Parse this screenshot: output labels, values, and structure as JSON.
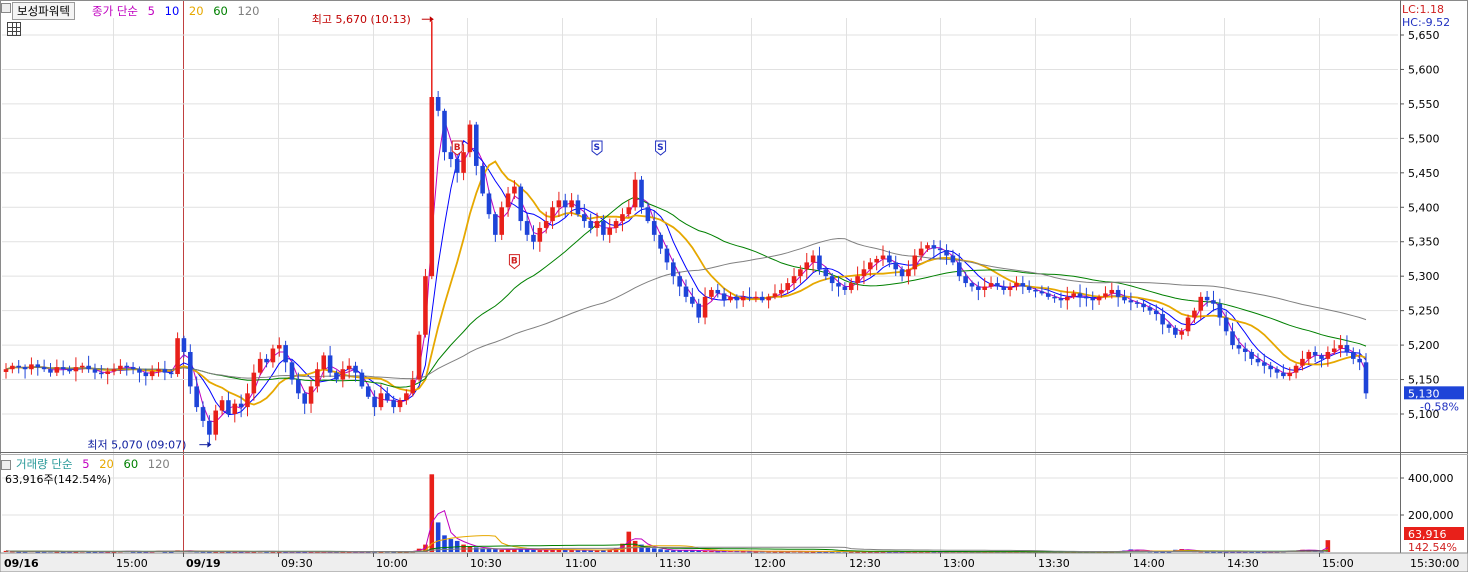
{
  "header": {
    "stock_name": "보성파워텍",
    "ma_prefix": "종가 단순",
    "ma_periods": [
      "5",
      "10",
      "20",
      "60",
      "120"
    ],
    "ma_colors": [
      "#c000c0",
      "#0000ff",
      "#e6a800",
      "#008000",
      "#808080"
    ]
  },
  "volume_header": {
    "label": "거래량 단순",
    "ma_periods": [
      "5",
      "20",
      "60",
      "120"
    ],
    "current": "63,916주(142.54%)"
  },
  "indicators": {
    "lc": "LC:1.18",
    "hc": "HC:-9.52"
  },
  "current_price": {
    "value": "5,130",
    "change": "-0.58%"
  },
  "current_volume": {
    "value": "63,916",
    "ratio": "142.54%"
  },
  "annotations": {
    "high": "최고 5,670 (10:13)",
    "low": "최저 5,070 (09:07)",
    "buy_label": "B",
    "sell_label": "S"
  },
  "colors": {
    "up": "#e8201a",
    "down": "#1e44d8",
    "grid": "#e1e1e1",
    "axis_bg": "#ffffff"
  },
  "chart_data": [
    {
      "type": "candlestick",
      "title": "",
      "x_ticks": [
        "09/16",
        "15:00",
        "09/19",
        "09:30",
        "10:00",
        "10:30",
        "11:00",
        "11:30",
        "12:00",
        "12:30",
        "13:00",
        "13:30",
        "14:00",
        "14:30",
        "15:00",
        "15:30:00"
      ],
      "y_ticks": [
        "5,100",
        "5,150",
        "5,200",
        "5,250",
        "5,300",
        "5,350",
        "5,400",
        "5,450",
        "5,500",
        "5,550",
        "5,600",
        "5,650"
      ],
      "ylim": [
        5060,
        5670
      ],
      "high": 5670,
      "low": 5070,
      "price_path": [
        5165,
        5170,
        5168,
        5165,
        5172,
        5168,
        5165,
        5160,
        5168,
        5165,
        5162,
        5168,
        5170,
        5165,
        5160,
        5158,
        5162,
        5165,
        5170,
        5168,
        5165,
        5160,
        5155,
        5162,
        5165,
        5160,
        5158,
        5210,
        5190,
        5140,
        5110,
        5090,
        5070,
        5105,
        5120,
        5100,
        5115,
        5110,
        5130,
        5160,
        5180,
        5175,
        5195,
        5200,
        5175,
        5150,
        5130,
        5115,
        5140,
        5165,
        5185,
        5160,
        5150,
        5165,
        5170,
        5160,
        5140,
        5125,
        5110,
        5130,
        5120,
        5110,
        5120,
        5130,
        5150,
        5215,
        5300,
        5560,
        5540,
        5480,
        5470,
        5450,
        5480,
        5520,
        5460,
        5420,
        5390,
        5360,
        5400,
        5420,
        5430,
        5380,
        5360,
        5350,
        5370,
        5380,
        5400,
        5410,
        5400,
        5410,
        5390,
        5380,
        5370,
        5380,
        5360,
        5370,
        5380,
        5390,
        5400,
        5440,
        5400,
        5380,
        5360,
        5340,
        5320,
        5300,
        5285,
        5270,
        5260,
        5240,
        5270,
        5280,
        5275,
        5265,
        5270,
        5265,
        5270,
        5268,
        5270,
        5265,
        5270,
        5275,
        5280,
        5290,
        5300,
        5310,
        5320,
        5330,
        5310,
        5300,
        5290,
        5285,
        5280,
        5290,
        5300,
        5310,
        5320,
        5325,
        5330,
        5320,
        5310,
        5300,
        5310,
        5330,
        5340,
        5345,
        5340,
        5338,
        5330,
        5320,
        5300,
        5290,
        5285,
        5280,
        5285,
        5290,
        5285,
        5280,
        5285,
        5290,
        5285,
        5280,
        5278,
        5275,
        5270,
        5268,
        5265,
        5270,
        5275,
        5270,
        5268,
        5265,
        5270,
        5275,
        5280,
        5270,
        5265,
        5262,
        5260,
        5255,
        5250,
        5245,
        5230,
        5225,
        5215,
        5220,
        5240,
        5250,
        5270,
        5265,
        5260,
        5240,
        5220,
        5200,
        5195,
        5190,
        5180,
        5175,
        5170,
        5165,
        5160,
        5155,
        5160,
        5170,
        5180,
        5190,
        5185,
        5180,
        5190,
        5195,
        5200,
        5190,
        5180,
        5175,
        5130
      ]
    },
    {
      "type": "bar",
      "title": "",
      "y_ticks": [
        "200,000",
        "400,000"
      ],
      "ylim": [
        0,
        460000
      ],
      "values": [
        6000,
        4000,
        2500,
        3000,
        5000,
        2000,
        3000,
        4000,
        2200,
        1800,
        3000,
        2500,
        4000,
        2000,
        1500,
        3000,
        2500,
        1800,
        4000,
        5000,
        3000,
        2000,
        1500,
        3500,
        6000,
        3000,
        2000,
        9000,
        6000,
        5000,
        4000,
        3000,
        2000,
        2500,
        3000,
        2000,
        1800,
        2200,
        3000,
        2500,
        4000,
        3000,
        2800,
        2000,
        1500,
        1800,
        2500,
        2200,
        2000,
        1500,
        1800,
        2000,
        2500,
        2200,
        1800,
        1500,
        2000,
        2500,
        3000,
        2200,
        3500,
        2000,
        1800,
        3000,
        4000,
        18000,
        40000,
        420000,
        160000,
        90000,
        70000,
        60000,
        40000,
        30000,
        25000,
        20000,
        18000,
        15000,
        12000,
        14000,
        16000,
        15000,
        14000,
        12000,
        10000,
        12000,
        14000,
        13000,
        12000,
        11000,
        10000,
        9000,
        8000,
        10000,
        12000,
        14000,
        20000,
        45000,
        110000,
        60000,
        40000,
        30000,
        20000,
        15000,
        10000,
        8000,
        9000,
        10000,
        8000,
        7000,
        6000,
        5000,
        4000,
        5000,
        6000,
        5000,
        4000,
        3500,
        3000,
        4000,
        3500,
        3000,
        2500,
        3000,
        4000,
        3500,
        3000,
        2500,
        2000,
        2500,
        3000,
        3500,
        4000,
        3000,
        2500,
        2000,
        2200,
        2500,
        2000,
        1800,
        1500,
        1800,
        2000,
        2200,
        2500,
        2000,
        1800,
        1500,
        1400,
        1200,
        1500,
        1800,
        1600,
        1400,
        1200,
        1000,
        1200,
        1400,
        1200,
        1000,
        900,
        1000,
        1100,
        1200,
        1300,
        1200,
        1100,
        1000,
        900,
        1000,
        1200,
        1500,
        3000,
        2000,
        1500,
        4000,
        8000,
        14000,
        10000,
        6000,
        4000,
        3000,
        2500,
        3000,
        12000,
        16000,
        8000,
        5000,
        4000,
        3000,
        2500,
        2000,
        1800,
        2000,
        2200,
        3000,
        2500,
        2000,
        1800,
        1500,
        3000,
        4000,
        6000,
        8000,
        12000,
        10000,
        6000,
        4000,
        63916
      ]
    }
  ]
}
